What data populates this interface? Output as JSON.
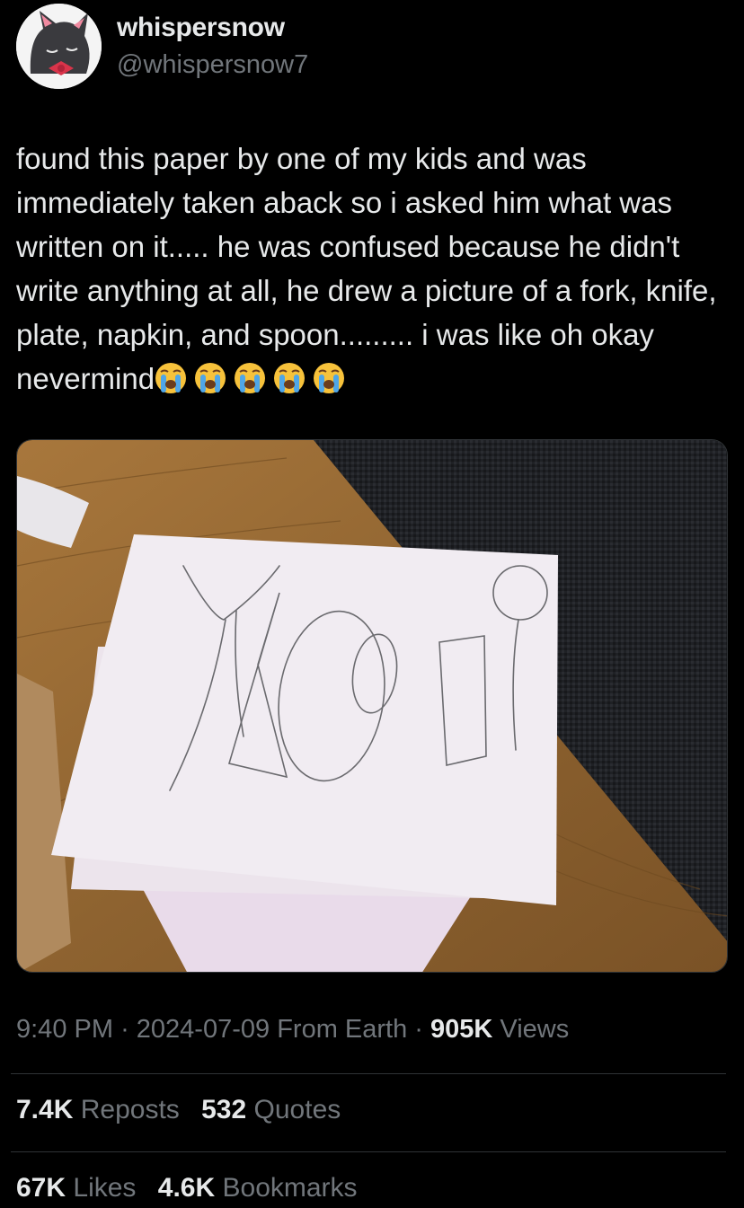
{
  "author": {
    "display_name": "whispersnow",
    "handle": "@whispersnow7"
  },
  "tweet": {
    "text": "found this paper by one of my kids and was immediately taken aback so i asked him what was written on it..... he was confused because he didn't write anything at all, he drew a picture of a fork, knife, plate, napkin, and spoon......... i was like oh okay nevermind",
    "emoji": [
      "loudly-crying-face",
      "loudly-crying-face",
      "loudly-crying-face",
      "loudly-crying-face",
      "loudly-crying-face"
    ]
  },
  "meta": {
    "time": "9:40 PM",
    "sep1": "·",
    "date": "2024-07-09",
    "source": "From Earth",
    "sep2": "·",
    "views_count": "905K",
    "views_label": "Views"
  },
  "stats": {
    "reposts_count": "7.4K",
    "reposts_label": "Reposts",
    "quotes_count": "532",
    "quotes_label": "Quotes",
    "likes_count": "67K",
    "likes_label": "Likes",
    "bookmarks_count": "4.6K",
    "bookmarks_label": "Bookmarks"
  },
  "colors": {
    "background": "#000000",
    "text_primary": "#e7e9ea",
    "text_secondary": "#71767b",
    "divider": "#2f3336"
  }
}
